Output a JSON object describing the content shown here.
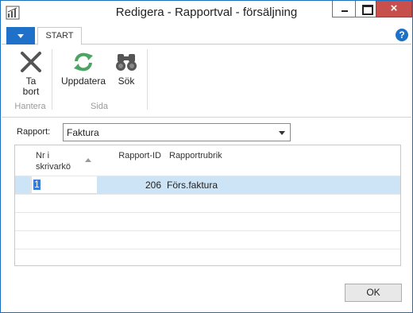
{
  "window": {
    "title": "Redigera - Rapportval - försäljning",
    "close_glyph": "×"
  },
  "ribbon": {
    "tab_start": "START",
    "help_glyph": "?",
    "actions": [
      {
        "label_line1": "Ta",
        "label_line2": "bort",
        "icon": "delete-x-icon"
      },
      {
        "label": "Uppdatera",
        "icon": "refresh-icon"
      },
      {
        "label": "Sök",
        "icon": "binoculars-icon"
      }
    ],
    "groups": [
      "Hantera",
      "Sida"
    ]
  },
  "form": {
    "rapport_label": "Rapport:",
    "rapport_value": "Faktura"
  },
  "grid": {
    "headers": {
      "nr_line1": "Nr i",
      "nr_line2": "skrivarkö",
      "rapport_id": "Rapport-ID",
      "rapportrubrik": "Rapportrubrik"
    },
    "rows": [
      {
        "nr": "1",
        "rapport_id": "206",
        "rapportrubrik": "Förs.faktura"
      }
    ]
  },
  "footer": {
    "ok_label": "OK"
  },
  "colors": {
    "accent": "#1e70c8",
    "close_button": "#c7504c",
    "selected_row": "#cde3f6"
  }
}
